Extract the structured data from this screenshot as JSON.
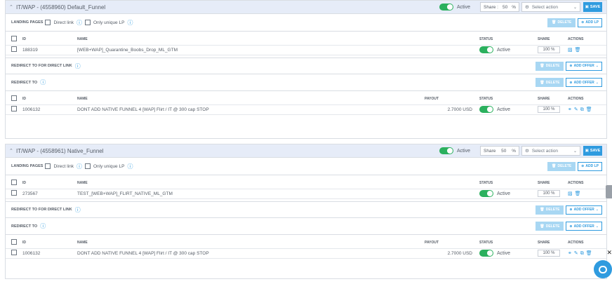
{
  "funnels": [
    {
      "title": "IT/WAP - (4558960) Default_Funnel",
      "status": "Active",
      "share_label": "Share :",
      "share_value": "50",
      "share_unit": "%",
      "select_action": "Select action",
      "save_label": "SAVE",
      "lp": {
        "title": "LANDING PAGES",
        "direct_link": "Direct link",
        "only_unique": "Only unique LP",
        "delete_label": "DELETE",
        "add_label": "ADD LP",
        "columns": {
          "id": "ID",
          "name": "NAME",
          "status": "STATUS",
          "share": "SHARE",
          "actions": "ACTIONS"
        },
        "rows": [
          {
            "id": "188319",
            "name": "[WEB+WAP]_Quarantine_Boobs_Drop_ML_GTM",
            "status": "Active",
            "share": "100 %"
          }
        ]
      },
      "redirect_direct": {
        "title": "REDIRECT TO FOR DIRECT LINK",
        "delete_label": "DELETE",
        "add_label": "ADD OFFER"
      },
      "redirect_to": {
        "title": "REDIRECT TO",
        "delete_label": "DELETE",
        "add_label": "ADD OFFER",
        "columns": {
          "id": "ID",
          "name": "NAME",
          "payout": "PAYOUT",
          "status": "STATUS",
          "share": "SHARE",
          "actions": "ACTIONS"
        },
        "rows": [
          {
            "id": "1006132",
            "name": "DONT ADD NATIVE FUNNEL 4 [WAP] Flirt / IT @ 300 cap STOP",
            "payout": "2.7000 USD",
            "status": "Active",
            "share": "100 %"
          }
        ]
      }
    },
    {
      "title": "IT/WAP - (4558961) Native_Funnel",
      "status": "Active",
      "share_label": "Share",
      "share_value": "50",
      "share_unit": "%",
      "select_action": "Select action",
      "save_label": "SAVE",
      "lp": {
        "title": "LANDING PAGES",
        "direct_link": "Direct link",
        "only_unique": "Only unique LP",
        "delete_label": "DELETE",
        "add_label": "ADD LP",
        "columns": {
          "id": "ID",
          "name": "NAME",
          "status": "STATUS",
          "share": "SHARE",
          "actions": "ACTIONS"
        },
        "rows": [
          {
            "id": "273567",
            "name": "TEST_[WEB+WAP]_FLIRT_NATIVE_ML_GTM",
            "status": "Active",
            "share": "100 %"
          }
        ]
      },
      "redirect_direct": {
        "title": "REDIRECT TO FOR DIRECT LINK",
        "delete_label": "DELETE",
        "add_label": "ADD OFFER"
      },
      "redirect_to": {
        "title": "REDIRECT TO",
        "delete_label": "DELETE",
        "add_label": "ADD OFFER",
        "columns": {
          "id": "ID",
          "name": "NAME",
          "payout": "PAYOUT",
          "status": "STATUS",
          "share": "SHARE",
          "actions": "ACTIONS"
        },
        "rows": [
          {
            "id": "1006132",
            "name": "DONT ADD NATIVE FUNNEL 4 [WAP] Flirt / IT @ 300 cap STOP",
            "payout": "2.7000 USD",
            "status": "Active",
            "share": "100 %"
          }
        ]
      }
    }
  ],
  "colors": {
    "accent": "#2f9bdf",
    "toggle_on": "#2bb05e",
    "header_bg": "#e6ecf8",
    "delete_disabled": "#a8d7f3"
  },
  "icons": [
    "chevron-up-icon",
    "settings-icon",
    "save-icon",
    "trash-icon",
    "plus-circle-icon",
    "image-icon",
    "link-icon",
    "pencil-icon",
    "copy-icon",
    "help-icon",
    "chat-icon",
    "close-icon"
  ]
}
